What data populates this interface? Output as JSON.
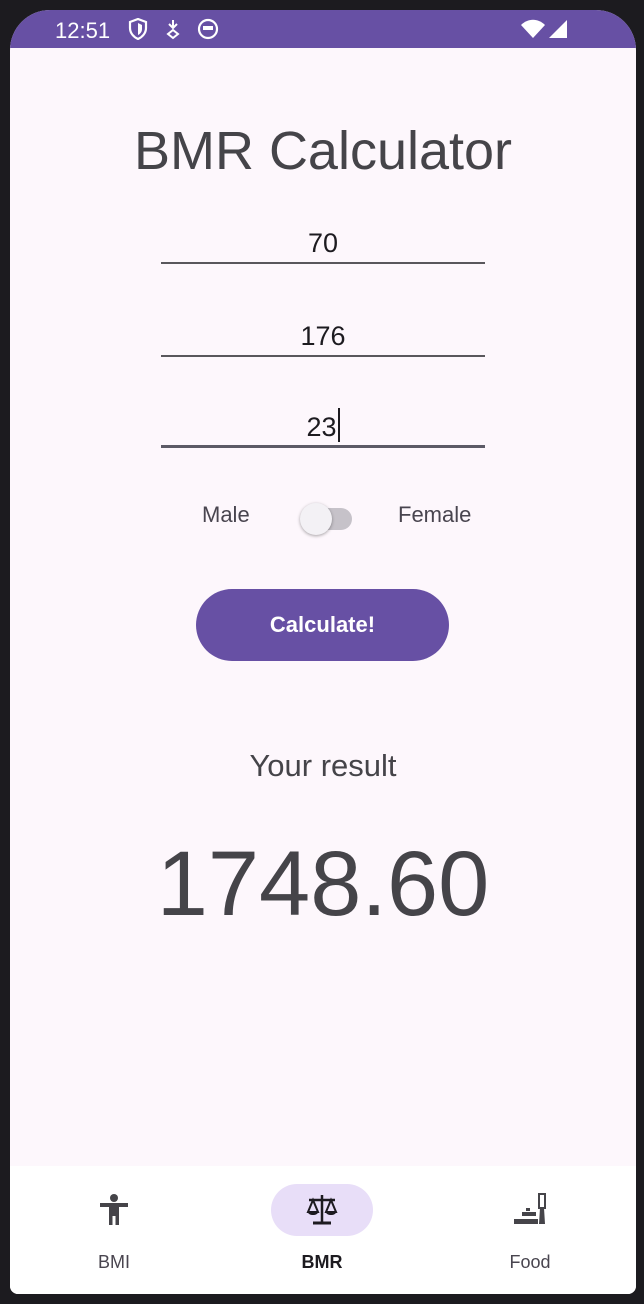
{
  "status_bar": {
    "time": "12:51",
    "icons": [
      "shield-icon",
      "download-icon",
      "app-icon",
      "wifi-icon",
      "signal-icon"
    ]
  },
  "page": {
    "title": "BMR Calculator"
  },
  "form": {
    "weight_value": "70",
    "height_value": "176",
    "age_value": "23",
    "gender_left_label": "Male",
    "gender_right_label": "Female",
    "gender_is_female": false,
    "calculate_label": "Calculate!"
  },
  "result": {
    "label": "Your result",
    "value": "1748.60"
  },
  "bottom_nav": {
    "items": [
      {
        "label": "BMI",
        "icon": "accessibility-icon",
        "active": false
      },
      {
        "label": "BMR",
        "icon": "scale-icon",
        "active": true
      },
      {
        "label": "Food",
        "icon": "food-icon",
        "active": false
      }
    ]
  },
  "colors": {
    "primary": "#6750a4",
    "background": "#fdf7fc",
    "active_indicator": "#e8def8"
  }
}
